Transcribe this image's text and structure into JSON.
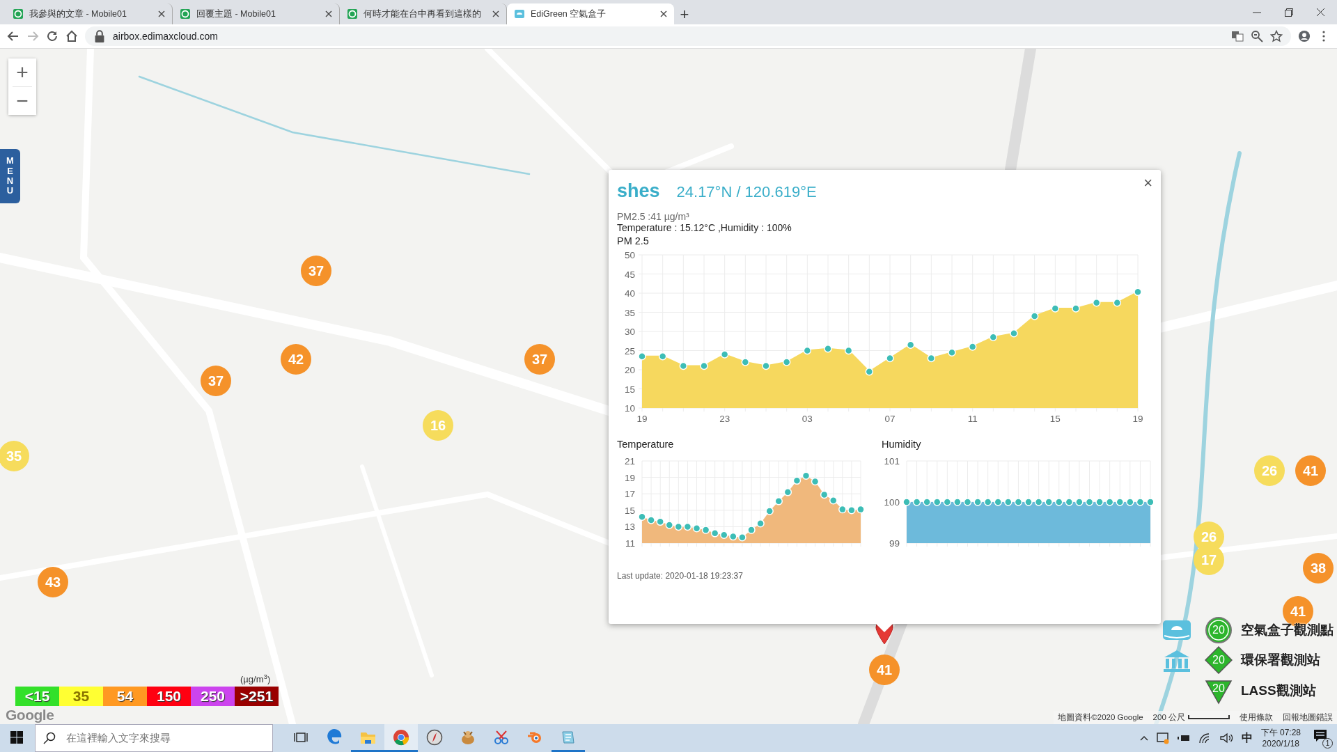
{
  "browser": {
    "tabs": [
      {
        "title": "我參與的文章 - Mobile01",
        "selected": false
      },
      {
        "title": "回覆主題 - Mobile01",
        "selected": false
      },
      {
        "title": "何時才能在台中再看到這樣的",
        "selected": false
      },
      {
        "title": "EdiGreen 空氣盒子",
        "selected": true
      }
    ],
    "new_tab": "+",
    "url": "airbox.edimaxcloud.com",
    "forward_disabled": true
  },
  "map": {
    "zoom_in": "+",
    "zoom_out": "−",
    "menu": "MENU",
    "markers": [
      {
        "value": "37",
        "color": "#f5922a",
        "selected": false
      },
      {
        "value": "42",
        "color": "#f5922a",
        "selected": false
      },
      {
        "value": "37",
        "color": "#f5922a",
        "selected": false
      },
      {
        "value": "37",
        "color": "#f5922a",
        "selected": false
      },
      {
        "value": "16",
        "color": "#f6dc5c",
        "selected": false
      },
      {
        "value": "35",
        "color": "#f6dc5c",
        "selected": false
      },
      {
        "value": "43",
        "color": "#f5922a",
        "selected": false
      },
      {
        "value": "26",
        "color": "#f6dc5c",
        "selected": false
      },
      {
        "value": "41",
        "color": "#f5922a",
        "selected": false
      },
      {
        "value": "26",
        "color": "#f6dc5c",
        "selected": false
      },
      {
        "value": "17",
        "color": "#f6dc5c",
        "selected": false
      },
      {
        "value": "38",
        "color": "#f5922a",
        "selected": false
      },
      {
        "value": "41",
        "color": "#f5922a",
        "selected": false
      },
      {
        "value": "41",
        "color": "#f5922a",
        "selected": true
      }
    ],
    "aqi_scale": {
      "unit": "(µg/m$^{3}$)",
      "levels": [
        {
          "label": "<15",
          "color": "#33e02a"
        },
        {
          "label": "35",
          "color": "#ffff33"
        },
        {
          "label": "54",
          "color": "#ff9922"
        },
        {
          "label": "150",
          "color": "#ff0011"
        },
        {
          "label": "250",
          "color": "#cc44ee"
        },
        {
          "label": ">251",
          "color": "#990000"
        }
      ]
    },
    "station_legend": [
      {
        "kind": "airbox",
        "value": "20",
        "label": "空氣盒子觀測點"
      },
      {
        "kind": "epa",
        "value": "20",
        "label": "環保署觀測站"
      },
      {
        "kind": "lass",
        "value": "20",
        "label": "LASS觀測站"
      }
    ],
    "footer": {
      "logo": "Google",
      "attribution": "地圖資料©2020 Google",
      "scale": "200 公尺",
      "terms": "使用條款",
      "report": "回報地圖錯誤"
    }
  },
  "popup": {
    "title": "shes",
    "coords": "24.17°N / 120.619°E",
    "close": "×",
    "pm25": "PM2.5 :41 µg/m³",
    "readings": "Temperature : 15.12°C ,Humidity : 100%",
    "charts": [
      {
        "chart_data": {
          "type": "area",
          "title": "PM 2.5",
          "grid": true,
          "categories": [
            "19",
            null,
            null,
            null,
            "23",
            null,
            null,
            null,
            "03",
            null,
            null,
            null,
            "07",
            null,
            null,
            null,
            "11",
            null,
            null,
            null,
            "15",
            null,
            null,
            null,
            "19"
          ],
          "series": [
            {
              "color": "#f6d85e",
              "values": [
                23.5,
                23.5,
                21,
                21,
                24,
                22,
                21,
                22,
                25,
                25.5,
                25,
                19.5,
                23,
                26.5,
                23,
                24.5,
                26,
                28.5,
                29.5,
                34,
                36,
                36,
                37.5,
                37.5,
                40.3
              ]
            }
          ],
          "ylim": [
            10,
            50
          ],
          "yticks": [
            10,
            15,
            20,
            25,
            30,
            35,
            40,
            45,
            50
          ]
        }
      },
      {
        "title": "Temperature",
        "axis_labels": [
          "21",
          "19",
          "17",
          "15",
          "13",
          "11"
        ]
      },
      {
        "title": "Humidity",
        "axis_labels": [
          "101",
          "100",
          "99"
        ]
      }
    ],
    "last_update": "Last update: 2020-01-18 19:23:37"
  },
  "taskbar": {
    "search_placeholder": "在這裡輸入文字來搜尋",
    "apps": [
      {
        "kind": "edge",
        "running": false,
        "selected": false
      },
      {
        "kind": "folder",
        "running": true,
        "selected": false
      },
      {
        "kind": "chrome",
        "running": true,
        "selected": true
      },
      {
        "kind": "compass",
        "running": false,
        "selected": false
      },
      {
        "kind": "animal",
        "running": false,
        "selected": false
      },
      {
        "kind": "scissors",
        "running": false,
        "selected": false
      },
      {
        "kind": "blender",
        "running": false,
        "selected": false
      },
      {
        "kind": "notepad",
        "running": true,
        "selected": false
      }
    ],
    "ime": "中",
    "time": "下午 07:28",
    "date": "2020/1/18",
    "notifications": "1"
  }
}
